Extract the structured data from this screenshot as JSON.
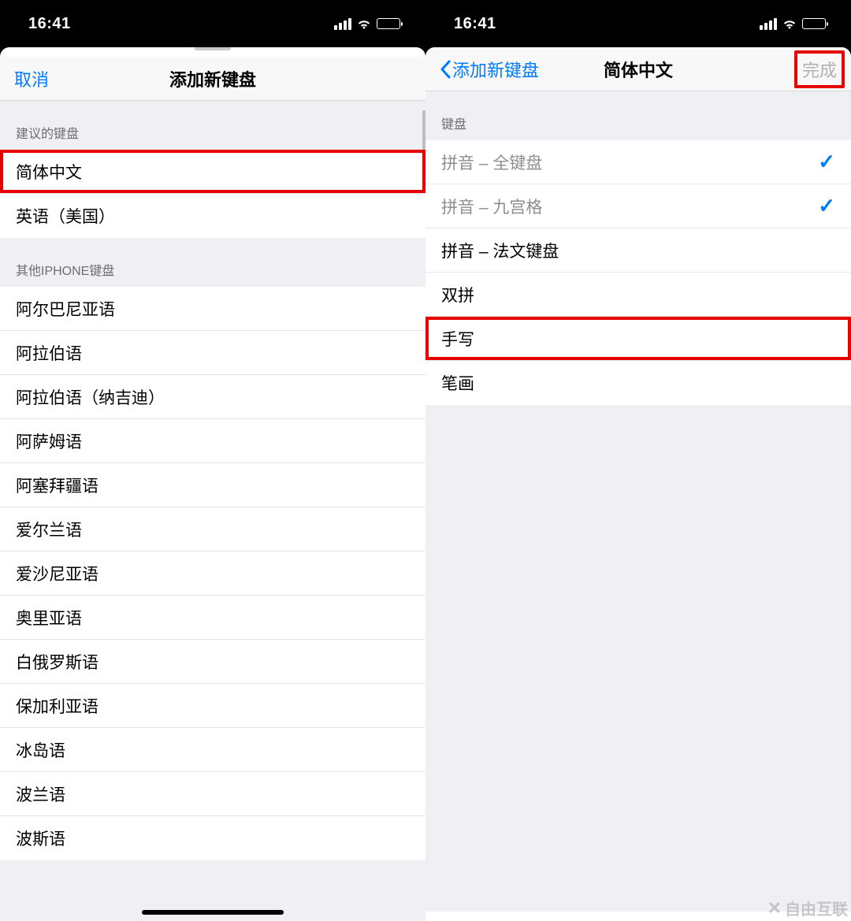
{
  "statusTime": "16:41",
  "left": {
    "cancel": "取消",
    "title": "添加新键盘",
    "section1": "建议的键盘",
    "suggested": [
      "简体中文",
      "英语（美国）"
    ],
    "section2": "其他IPHONE键盘",
    "others": [
      "阿尔巴尼亚语",
      "阿拉伯语",
      "阿拉伯语（纳吉迪）",
      "阿萨姆语",
      "阿塞拜疆语",
      "爱尔兰语",
      "爱沙尼亚语",
      "奥里亚语",
      "白俄罗斯语",
      "保加利亚语",
      "冰岛语",
      "波兰语",
      "波斯语"
    ]
  },
  "right": {
    "back": "添加新键盘",
    "title": "简体中文",
    "done": "完成",
    "section": "键盘",
    "options": [
      {
        "label": "拼音 – 全键盘",
        "checked": true,
        "disabled": true
      },
      {
        "label": "拼音 – 九宫格",
        "checked": true,
        "disabled": true
      },
      {
        "label": "拼音 – 法文键盘",
        "checked": false,
        "disabled": false
      },
      {
        "label": "双拼",
        "checked": false,
        "disabled": false
      },
      {
        "label": "手写",
        "checked": false,
        "disabled": false,
        "highlight": true
      },
      {
        "label": "笔画",
        "checked": false,
        "disabled": false
      }
    ]
  },
  "watermark": "自由互联"
}
